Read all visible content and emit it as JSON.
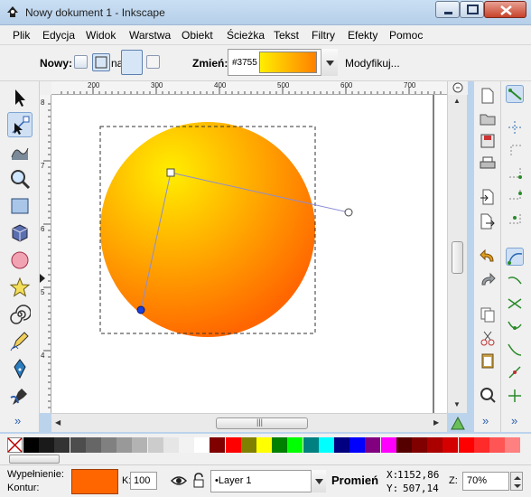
{
  "window": {
    "title": "Nowy dokument 1 - Inkscape",
    "controls": [
      "minimize-icon",
      "maximize-icon",
      "close-icon"
    ]
  },
  "menu": {
    "items": [
      {
        "label": "Plik"
      },
      {
        "label": "Edycja"
      },
      {
        "label": "Widok"
      },
      {
        "label": "Warstwa"
      },
      {
        "label": "Obiekt"
      },
      {
        "label": "Ścieżka"
      },
      {
        "label": "Tekst"
      },
      {
        "label": "Filtry"
      },
      {
        "label": "Efekty"
      },
      {
        "label": "Pomoc"
      }
    ]
  },
  "tool_controls": {
    "new_label": "Nowy:",
    "new_on_label": "na",
    "change_label": "Zmień:",
    "gradient_name": "#3755",
    "gradient_colors": [
      "#ffee00",
      "#ff8000"
    ],
    "edit_button": "Modyfikuj..."
  },
  "toolbox": {
    "tools": [
      "selector-icon",
      "node-editor-icon",
      "tweak-icon",
      "zoom-icon",
      "rectangle-icon",
      "box-3d-icon",
      "ellipse-icon",
      "star-icon",
      "spiral-icon",
      "pencil-icon",
      "pen-icon",
      "calligraphy-icon"
    ],
    "active": "node-editor-icon",
    "more": "»"
  },
  "rulers": {
    "horizontal": [
      "200",
      "300",
      "400",
      "500",
      "600",
      "700"
    ],
    "vertical": [
      "8",
      "7",
      "6",
      "5",
      "4"
    ]
  },
  "canvas": {
    "object": "circle",
    "gradient_type": "radial",
    "gradient_colors": [
      "#ffee00",
      "#ff6600"
    ]
  },
  "scrollbars": {
    "horizontal_more": "»",
    "thumb_grip": "|||"
  },
  "command_bar": {
    "icons": [
      "new-document-icon",
      "open-icon",
      "save-icon",
      "print-icon",
      "import-icon",
      "export-icon",
      "undo-icon",
      "redo-icon",
      "copy-icon",
      "cut-icon",
      "paste-icon",
      "zoom-selection-icon"
    ],
    "more": "»"
  },
  "snap_bar": {
    "icons": [
      "snap-toggle-icon",
      "snap-bbox-icon",
      "snap-bbox-edge-icon",
      "snap-bbox-corner-icon",
      "snap-bbox-midpoint-icon",
      "snap-nodes-icon",
      "snap-paths-icon",
      "snap-intersection-icon",
      "snap-smooth-node-icon",
      "snap-midpoint-icon",
      "snap-center-icon",
      "snap-rotation-icon",
      "snap-page-icon"
    ],
    "more": "»"
  },
  "palette": {
    "none_icon": "no-paint-icon",
    "colors": [
      "#000000",
      "#1a1a1a",
      "#333333",
      "#4d4d4d",
      "#666666",
      "#808080",
      "#999999",
      "#b3b3b3",
      "#cccccc",
      "#e6e6e6",
      "#f2f2f2",
      "#ffffff",
      "#800000",
      "#ff0000",
      "#808000",
      "#ffff00",
      "#008000",
      "#00ff00",
      "#008080",
      "#00ffff",
      "#000080",
      "#0000ff",
      "#800080",
      "#ff00ff",
      "#550000",
      "#800000",
      "#aa0000",
      "#d40000",
      "#ff0000",
      "#ff2a2a",
      "#ff5555",
      "#ff8080"
    ]
  },
  "status": {
    "fill_label": "Wypełnienie:",
    "stroke_label": "Kontur:",
    "fill_color": "#ff6600",
    "opacity_label": "K:",
    "opacity_value": "100",
    "layer_name": "•Layer 1",
    "message": "Promień g",
    "x_label": "X:",
    "x_value": "1152,86",
    "y_label": "Y:",
    "y_value": "507,14",
    "zoom_label": "Z:",
    "zoom_value": "70%"
  }
}
